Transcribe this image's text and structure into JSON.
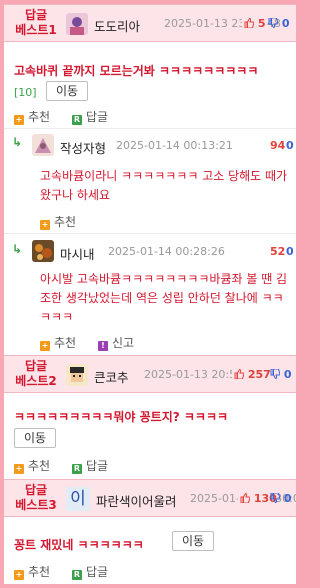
{
  "best1": {
    "badge_line1": "답글",
    "badge_line2": "베스트1",
    "nick": "도도리아",
    "date": "2025-01-13 23:51:48",
    "up": "5",
    "down": "0",
    "title": "고속바퀴 끝까지 모르는거봐 ㅋㅋㅋㅋㅋㅋㅋㅋㅋ",
    "count": "[10]",
    "move_label": "이동",
    "recommend_label": "추천",
    "reply_label": "답글"
  },
  "replies": [
    {
      "nick": "작성자형",
      "date": "2025-01-14 00:13:21",
      "up": "94",
      "down": "0",
      "text": "고속바큠이라니 ㅋㅋㅋㅋㅋㅋㅋ 고소 당해도 때가 왔구나 하세요",
      "recommend_label": "추천"
    },
    {
      "nick": "마시내",
      "date": "2025-01-14 00:28:26",
      "up": "52",
      "down": "0",
      "text": "아시발 고속바큠ㅋㅋㅋㅋㅋㅋㅋㅋ바큠좌 볼 땐 김조한 생각났었는데 역은 성립 안하던 찰나에 ㅋㅋㅋㅋㅋ",
      "recommend_label": "추천",
      "report_label": "신고"
    }
  ],
  "best2": {
    "badge_line1": "답글",
    "badge_line2": "베스트2",
    "nick": "큰코추",
    "date": "2025-01-13 20:59:40",
    "up": "257",
    "down": "0",
    "title": "ㅋㅋㅋㅋㅋㅋㅋㅋㅋ뭐야 꽁트지? ㅋㅋㅋㅋ",
    "move_label": "이동",
    "recommend_label": "추천",
    "reply_label": "답글"
  },
  "best3": {
    "badge_line1": "답글",
    "badge_line2": "베스트3",
    "avatar_text": "이",
    "nick": "파란색이어울려",
    "date": "2025-01-13 21:30:00",
    "up": "130",
    "down": "0",
    "title": "꽁트 재밌네 ㅋㅋㅋㅋㅋㅋ",
    "move_label": "이동",
    "recommend_label": "추천",
    "reply_label": "답글"
  },
  "colors": {
    "accent_red": "#d3182f",
    "best_bg": "#fde4e8",
    "page_border": "#f7a8b4",
    "up_red": "#e0413b",
    "down_blue": "#3a62d8"
  }
}
